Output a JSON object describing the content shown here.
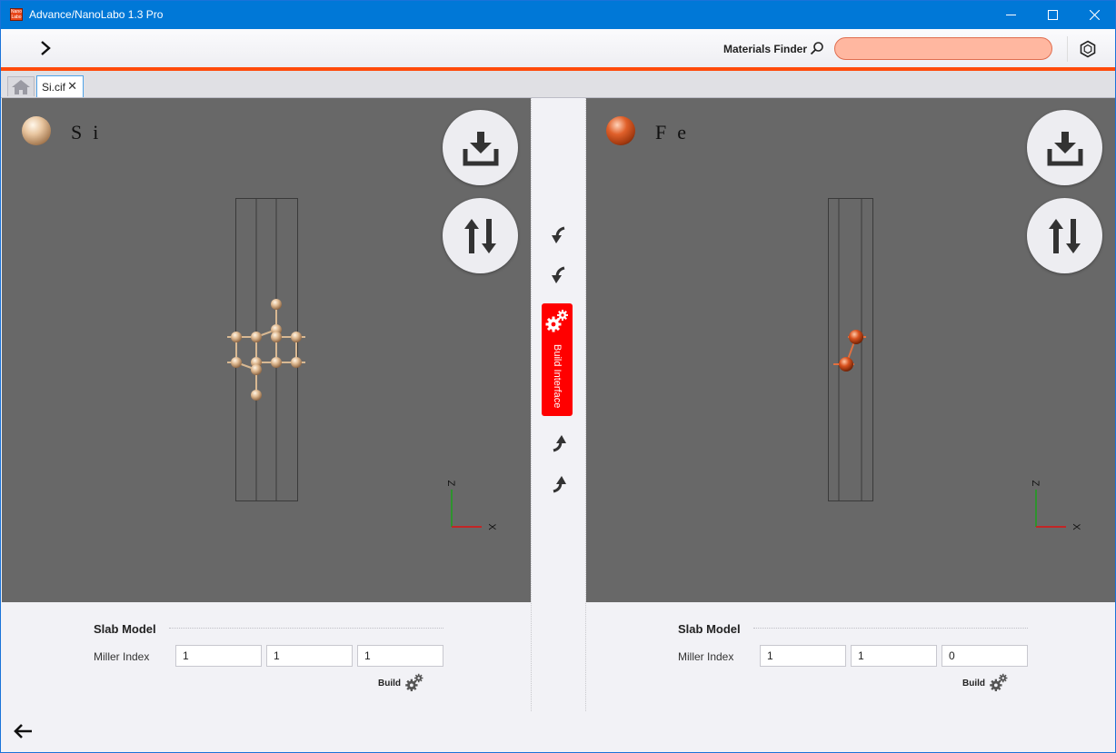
{
  "window": {
    "title": "Advance/NanoLabo 1.3 Pro",
    "app_icon_text": "Nano Labo",
    "controls": [
      "minimize-icon",
      "maximize-icon",
      "close-icon"
    ]
  },
  "toolbar": {
    "expand_icon": "chevron-right-icon",
    "materials_finder_label": "Materials Finder",
    "search_icon": "search-icon",
    "search_value": "",
    "structure_icon": "hexagon-icon",
    "accent_color": "#ff4b0b"
  },
  "tabs": {
    "home_icon": "home-icon",
    "items": [
      {
        "label": "Si.cif",
        "close": "✕",
        "active": true
      }
    ]
  },
  "left_panel": {
    "element": "Si",
    "element_color": "#e2bf98",
    "download_icon": "download-icon",
    "swap_icon": "swap-icon",
    "axes": {
      "z": "Z",
      "x": "X"
    },
    "slab": {
      "title": "Slab Model",
      "miller_label": "Miller Index",
      "miller": [
        "1",
        "1",
        "1"
      ],
      "build_label": "Build"
    }
  },
  "right_panel": {
    "element": "Fe",
    "element_color": "#d9521f",
    "download_icon": "download-icon",
    "swap_icon": "swap-icon",
    "axes": {
      "z": "Z",
      "x": "X"
    },
    "slab": {
      "title": "Slab Model",
      "miller_label": "Miller Index",
      "miller": [
        "1",
        "1",
        "0"
      ],
      "build_label": "Build"
    }
  },
  "middle": {
    "build_interface_label": "Build Interface",
    "build_interface_color": "#ff0000",
    "arrow_icons": [
      "curved-arrow-down-left-icon",
      "curved-arrow-down-left-icon",
      "curved-arrow-up-right-icon",
      "curved-arrow-up-right-icon"
    ]
  },
  "footer": {
    "back_icon": "arrow-left-icon"
  }
}
